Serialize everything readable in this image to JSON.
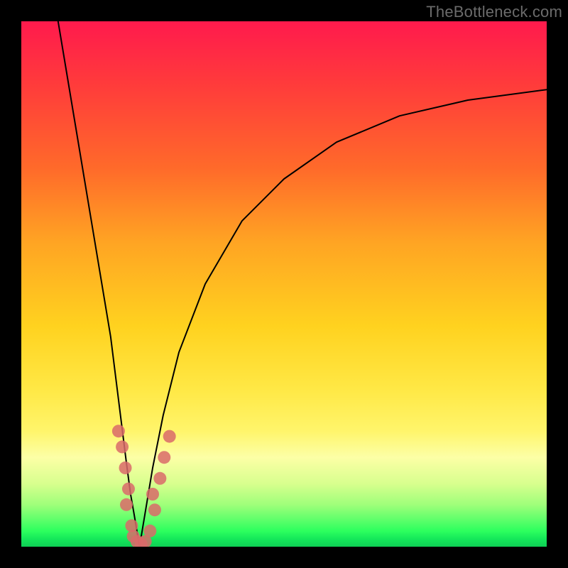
{
  "watermark": "TheBottleneck.com",
  "chart_data": {
    "type": "line",
    "title": "",
    "xlabel": "",
    "ylabel": "",
    "xlim": [
      0,
      100
    ],
    "ylim": [
      0,
      100
    ],
    "gradient_stops": [
      {
        "pct": 0,
        "color": "#ff1a4d"
      },
      {
        "pct": 12,
        "color": "#ff3b3b"
      },
      {
        "pct": 28,
        "color": "#ff6a2a"
      },
      {
        "pct": 42,
        "color": "#ffa423"
      },
      {
        "pct": 58,
        "color": "#ffd21f"
      },
      {
        "pct": 70,
        "color": "#ffe845"
      },
      {
        "pct": 78,
        "color": "#fff56b"
      },
      {
        "pct": 83,
        "color": "#fcffa6"
      },
      {
        "pct": 88,
        "color": "#d8ff8e"
      },
      {
        "pct": 92,
        "color": "#9fff7a"
      },
      {
        "pct": 95,
        "color": "#5bff6a"
      },
      {
        "pct": 97,
        "color": "#2dff5e"
      },
      {
        "pct": 98.5,
        "color": "#15e85a"
      },
      {
        "pct": 100,
        "color": "#0ecf55"
      }
    ],
    "series": [
      {
        "name": "left-branch",
        "x": [
          7,
          9,
          11,
          13,
          15,
          17,
          18,
          19,
          20,
          20.8,
          21.5,
          22,
          22.5
        ],
        "y": [
          100,
          88,
          76,
          64,
          52,
          40,
          32,
          24,
          16,
          10,
          6,
          3,
          0
        ]
      },
      {
        "name": "right-branch",
        "x": [
          22.5,
          23,
          24,
          25,
          27,
          30,
          35,
          42,
          50,
          60,
          72,
          85,
          100
        ],
        "y": [
          0,
          3,
          9,
          15,
          25,
          37,
          50,
          62,
          70,
          77,
          82,
          85,
          87
        ]
      }
    ],
    "markers": {
      "name": "highlight-dots",
      "color": "#d96a6a",
      "radius_px": 9,
      "points": [
        {
          "x": 18.5,
          "y": 22
        },
        {
          "x": 19.2,
          "y": 19
        },
        {
          "x": 19.8,
          "y": 15
        },
        {
          "x": 20.4,
          "y": 11
        },
        {
          "x": 20.0,
          "y": 8
        },
        {
          "x": 21.0,
          "y": 4
        },
        {
          "x": 21.3,
          "y": 2
        },
        {
          "x": 22.0,
          "y": 1
        },
        {
          "x": 22.8,
          "y": 0.5
        },
        {
          "x": 23.6,
          "y": 1
        },
        {
          "x": 24.5,
          "y": 3
        },
        {
          "x": 25.4,
          "y": 7
        },
        {
          "x": 25.0,
          "y": 10
        },
        {
          "x": 26.4,
          "y": 13
        },
        {
          "x": 27.2,
          "y": 17
        },
        {
          "x": 28.2,
          "y": 21
        }
      ]
    }
  }
}
